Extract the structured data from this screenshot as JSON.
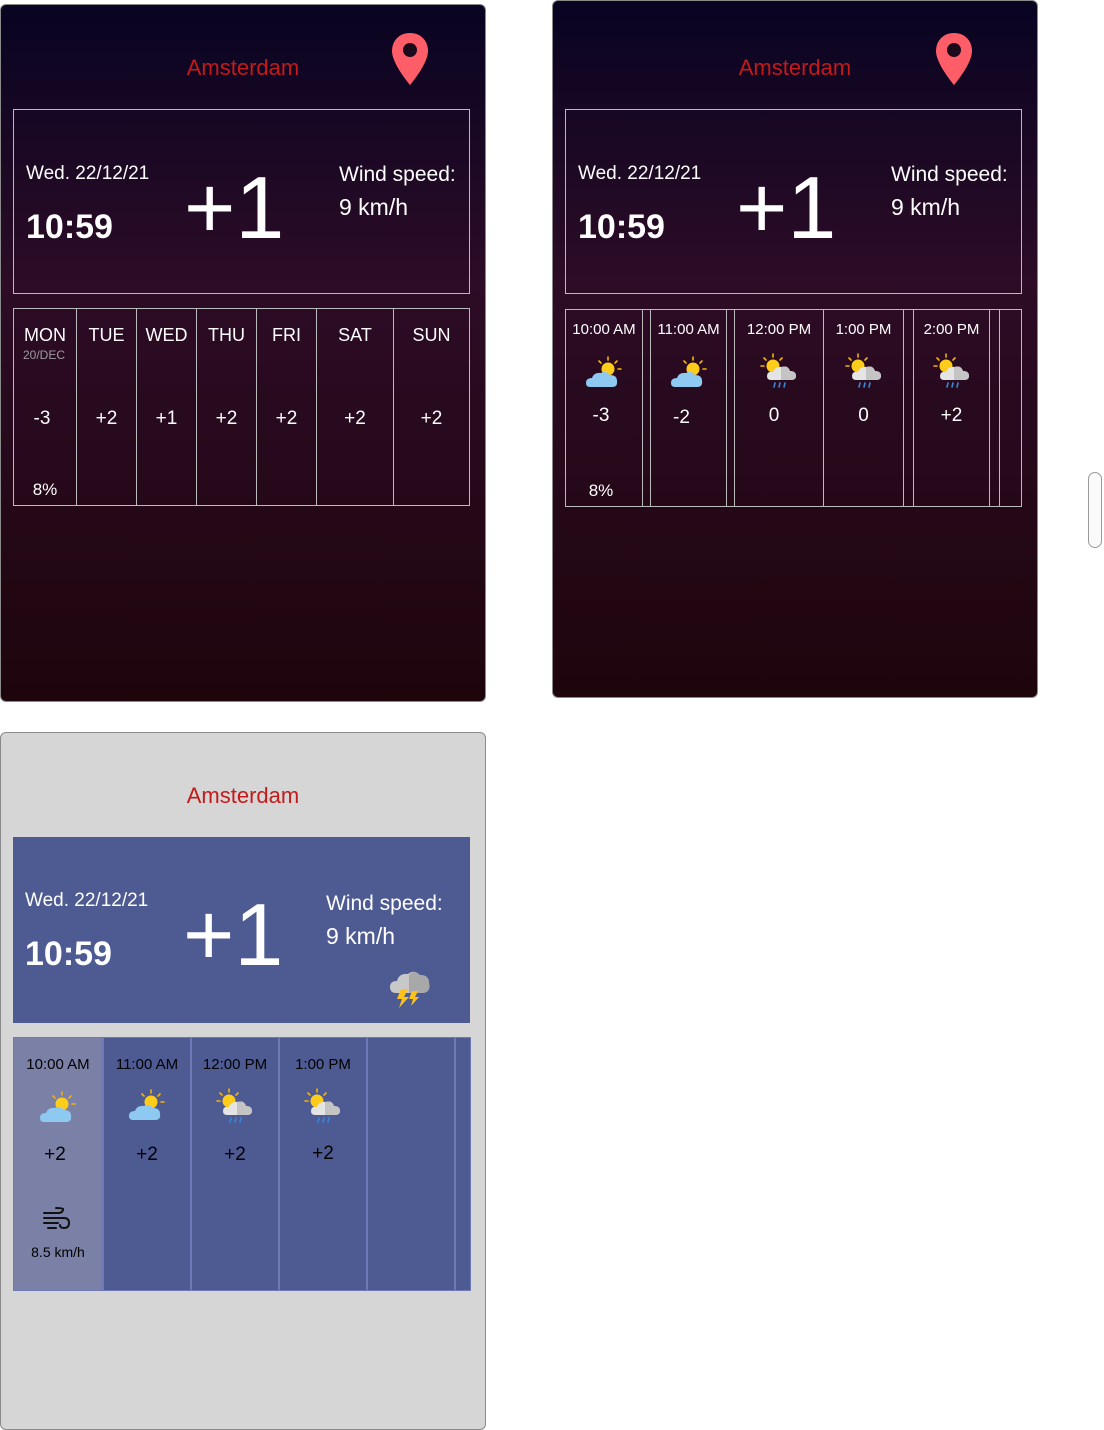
{
  "colors": {
    "city": "#c41a1a",
    "pin": "#ff5d67",
    "dark_bg_top": "#080422",
    "dark_bg_bottom": "#1e050c",
    "light_bg": "#d6d6d6",
    "panel_blue": "#4e5a92",
    "selected_col": "#7a80a6"
  },
  "city": "Amsterdam",
  "current": {
    "date": "Wed. 22/12/21",
    "time": "10:59",
    "temp": "+1",
    "wind_label": "Wind speed:",
    "wind_value": "9 km/h"
  },
  "weekly": {
    "days": [
      {
        "day": "MON",
        "date": "20/DEC",
        "temp": "-3",
        "precip": "8%"
      },
      {
        "day": "TUE",
        "temp": "+2"
      },
      {
        "day": "WED",
        "temp": "+1"
      },
      {
        "day": "THU",
        "temp": "+2"
      },
      {
        "day": "FRI",
        "temp": "+2"
      },
      {
        "day": "SAT",
        "temp": "+2"
      },
      {
        "day": "SUN",
        "temp": "+2"
      }
    ]
  },
  "hourly_dark": {
    "hours": [
      {
        "time": "10:00 AM",
        "icon": "partly-cloudy-icon",
        "temp": "-3",
        "precip": "8%"
      },
      {
        "time": "11:00 AM",
        "icon": "partly-cloudy-icon",
        "temp": "-2"
      },
      {
        "time": "12:00 PM",
        "icon": "sun-rain-cloud-icon",
        "temp": "0"
      },
      {
        "time": "1:00 PM",
        "icon": "sun-rain-cloud-icon",
        "temp": "0"
      },
      {
        "time": "2:00 PM",
        "icon": "sun-rain-cloud-icon",
        "temp": "+2"
      }
    ]
  },
  "hourly_light": {
    "current_icon": "thunderstorm-icon",
    "hours": [
      {
        "time": "10:00 AM",
        "icon": "partly-cloudy-icon",
        "temp": "+2",
        "wind_icon": "wind-icon",
        "wind": "8.5 km/h",
        "selected": true
      },
      {
        "time": "11:00 AM",
        "icon": "partly-cloudy-icon",
        "temp": "+2"
      },
      {
        "time": "12:00 PM",
        "icon": "sun-rain-cloud-icon",
        "temp": "+2"
      },
      {
        "time": "1:00 PM",
        "icon": "sun-rain-cloud-icon",
        "temp": "+2"
      }
    ]
  }
}
